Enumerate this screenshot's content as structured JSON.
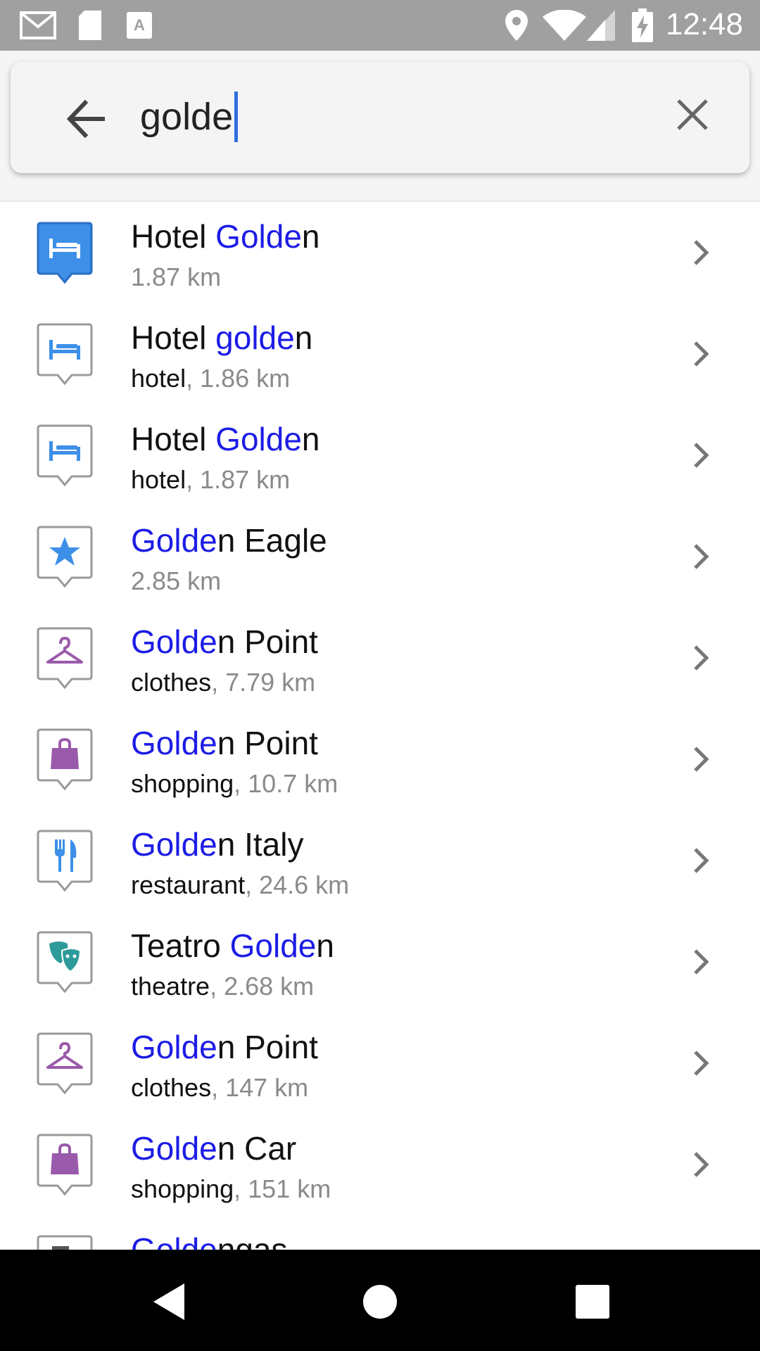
{
  "status_bar": {
    "time": "12:48",
    "icons": [
      "gmail-icon",
      "sd-card-icon",
      "keyboard-icon",
      "location-icon",
      "wifi-icon",
      "signal-icon",
      "battery-charging-icon"
    ],
    "background": "#a0a0a0"
  },
  "search": {
    "query": "golde",
    "back_icon": "arrow-left-icon",
    "clear_icon": "close-icon",
    "caret_color": "#2e6fe0"
  },
  "results": [
    {
      "icon": "hotel-selected-icon",
      "title_pre": "Hotel ",
      "title_hl": "Golde",
      "title_post": "n",
      "category": "",
      "distance": "1.87 km"
    },
    {
      "icon": "hotel-icon",
      "title_pre": "Hotel ",
      "title_hl": "golde",
      "title_post": "n",
      "category": "hotel",
      "distance": ", 1.86 km"
    },
    {
      "icon": "hotel-icon",
      "title_pre": "Hotel ",
      "title_hl": "Golde",
      "title_post": "n",
      "category": "hotel",
      "distance": ", 1.87 km"
    },
    {
      "icon": "star-icon",
      "title_pre": "",
      "title_hl": "Golde",
      "title_post": "n Eagle",
      "category": "",
      "distance": "2.85 km"
    },
    {
      "icon": "hanger-icon",
      "title_pre": "",
      "title_hl": "Golde",
      "title_post": "n Point",
      "category": "clothes",
      "distance": ", 7.79 km"
    },
    {
      "icon": "shopping-bag-icon",
      "title_pre": "",
      "title_hl": "Golde",
      "title_post": "n Point",
      "category": "shopping",
      "distance": ", 10.7 km"
    },
    {
      "icon": "fork-knife-icon",
      "title_pre": "",
      "title_hl": "Golde",
      "title_post": "n Italy",
      "category": "restaurant",
      "distance": ", 24.6 km"
    },
    {
      "icon": "theatre-masks-icon",
      "title_pre": "Teatro ",
      "title_hl": "Golde",
      "title_post": "n",
      "category": "theatre",
      "distance": ", 2.68 km"
    },
    {
      "icon": "hanger-icon",
      "title_pre": "",
      "title_hl": "Golde",
      "title_post": "n Point",
      "category": "clothes",
      "distance": ", 147 km"
    },
    {
      "icon": "shopping-bag-icon",
      "title_pre": "",
      "title_hl": "Golde",
      "title_post": "n Car",
      "category": "shopping",
      "distance": ", 151 km"
    },
    {
      "icon": "fuel-icon",
      "title_pre": "",
      "title_hl": "Golde",
      "title_post": "ngas",
      "category": "",
      "distance": ""
    }
  ],
  "colors": {
    "highlight": "#1c1ce6",
    "hotel_blue": "#3d8fe8",
    "purple": "#9a5aab",
    "teal": "#2e9b9b",
    "distance_gray": "#8a8a8a"
  },
  "nav_bar": {
    "back_icon": "nav-back-icon",
    "home_icon": "nav-home-icon",
    "recents_icon": "nav-recents-icon"
  }
}
